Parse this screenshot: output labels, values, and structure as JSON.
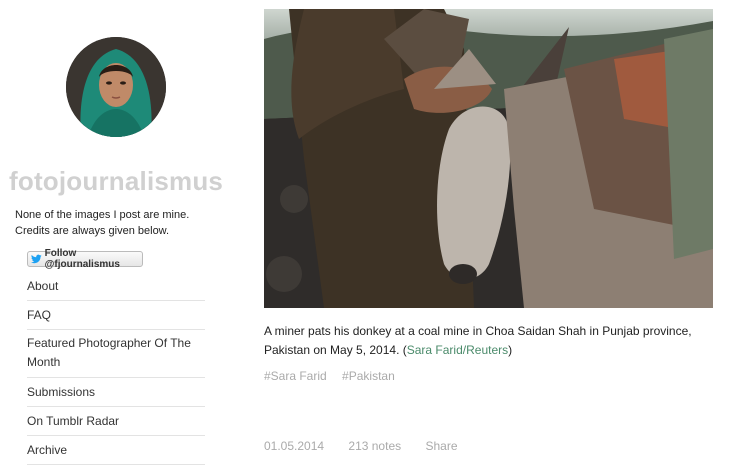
{
  "blog": {
    "title": "fotojournalismus",
    "description_line1": "None of the images I post are mine.",
    "description_line2": "Credits are always given below.",
    "follow_label": "Follow @fjournalismus"
  },
  "nav": {
    "items": [
      {
        "label": "About"
      },
      {
        "label": "FAQ"
      },
      {
        "label": "Featured Photographer Of The Month"
      },
      {
        "label": "Submissions"
      },
      {
        "label": "On Tumblr Radar"
      },
      {
        "label": "Archive"
      }
    ]
  },
  "post": {
    "caption": "A miner pats his donkey at a coal mine in Choa Saidan Shah in Punjab province, Pakistan on May 5, 2014. ",
    "credit_open": "(",
    "credit": "Sara Farid/Reuters",
    "credit_close": ")",
    "tags": [
      "#Sara Farid",
      "#Pakistan"
    ],
    "date": "01.05.2014",
    "notes": "213 notes",
    "share": "Share"
  },
  "colors": {
    "title": "#d0d0d0",
    "link": "#4a8a6a",
    "muted": "#aaaaaa",
    "twitter": "#1da1f2"
  },
  "icons": {
    "follow": "twitter-bird-icon"
  }
}
